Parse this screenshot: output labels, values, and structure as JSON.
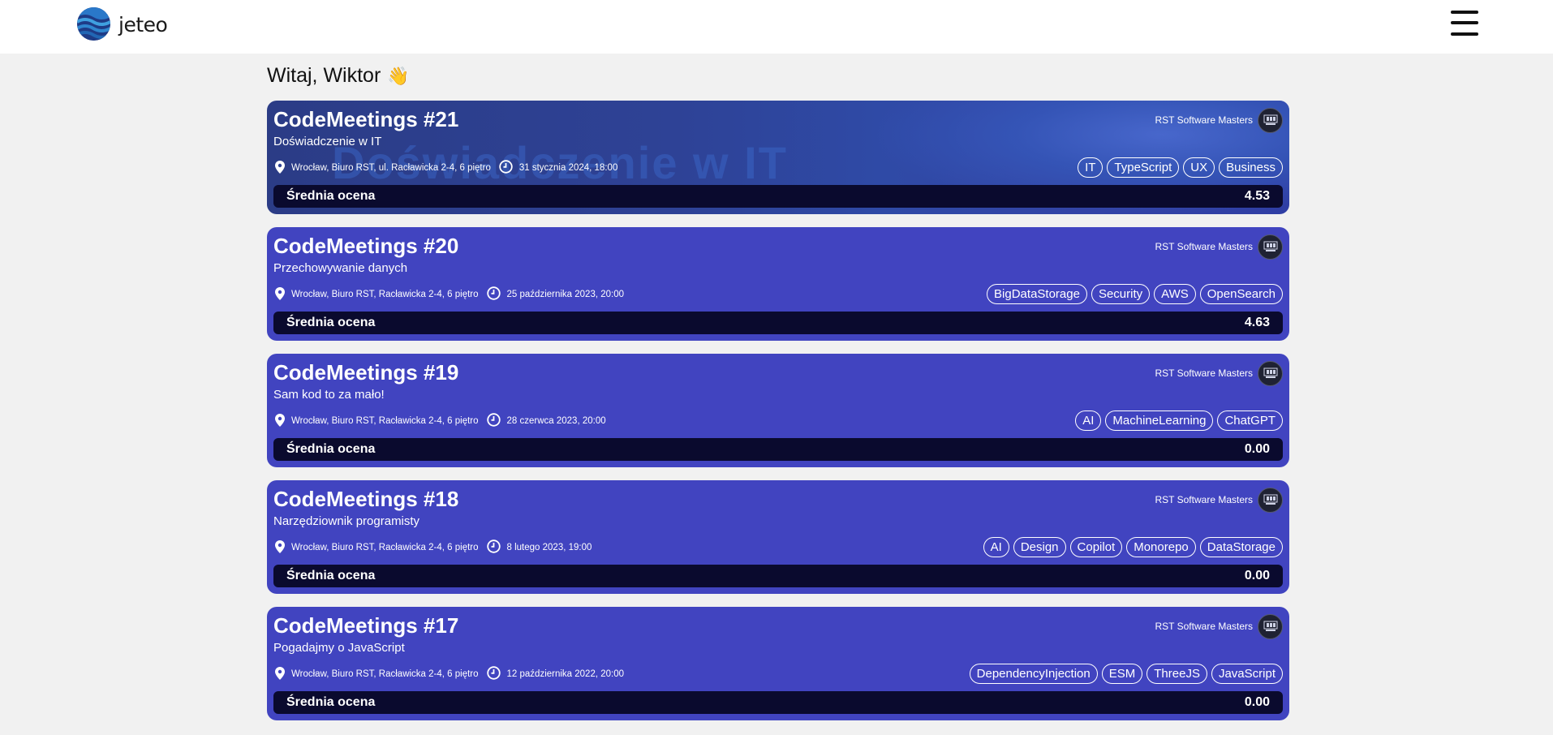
{
  "app": {
    "name": "jeteo"
  },
  "greeting": {
    "text": "Witaj, Wiktor",
    "emoji": "👋"
  },
  "colors": {
    "card": "#4144c0",
    "rating_bar": "#0a0a2e",
    "topbar": "#ffffff",
    "background": "#f1f1f1"
  },
  "icons": {
    "location": "map-pin-icon",
    "time": "clock-icon",
    "menu": "hamburger-menu-icon"
  },
  "events": [
    {
      "title": "CodeMeetings #21",
      "subtitle": "Doświadczenie w IT",
      "organizer": "RST Software Masters",
      "location": "Wrocław, Biuro RST, ul. Racławicka 2-4, 6 piętro",
      "date": "31 stycznia 2024, 18:00",
      "tags": [
        "IT",
        "TypeScript",
        "UX",
        "Business"
      ],
      "rating_label": "Średnia ocena",
      "rating": "4.53",
      "banner_text": "Doświadczenie w IT"
    },
    {
      "title": "CodeMeetings #20",
      "subtitle": "Przechowywanie danych",
      "organizer": "RST Software Masters",
      "location": "Wrocław, Biuro RST, Racławicka 2-4, 6 piętro",
      "date": "25 października 2023, 20:00",
      "tags": [
        "BigDataStorage",
        "Security",
        "AWS",
        "OpenSearch"
      ],
      "rating_label": "Średnia ocena",
      "rating": "4.63"
    },
    {
      "title": "CodeMeetings #19",
      "subtitle": "Sam kod to za mało!",
      "organizer": "RST Software Masters",
      "location": "Wrocław, Biuro RST, Racławicka 2-4, 6 piętro",
      "date": "28 czerwca 2023, 20:00",
      "tags": [
        "AI",
        "MachineLearning",
        "ChatGPT"
      ],
      "rating_label": "Średnia ocena",
      "rating": "0.00"
    },
    {
      "title": "CodeMeetings #18",
      "subtitle": "Narzędziownik programisty",
      "organizer": "RST Software Masters",
      "location": "Wrocław, Biuro RST, Racławicka 2-4, 6 piętro",
      "date": "8 lutego 2023, 19:00",
      "tags": [
        "AI",
        "Design",
        "Copilot",
        "Monorepo",
        "DataStorage"
      ],
      "rating_label": "Średnia ocena",
      "rating": "0.00"
    },
    {
      "title": "CodeMeetings #17",
      "subtitle": "Pogadajmy o JavaScript",
      "organizer": "RST Software Masters",
      "location": "Wrocław, Biuro RST, Racławicka 2-4, 6 piętro",
      "date": "12 października 2022, 20:00",
      "tags": [
        "DependencyInjection",
        "ESM",
        "ThreeJS",
        "JavaScript"
      ],
      "rating_label": "Średnia ocena",
      "rating": "0.00"
    }
  ]
}
